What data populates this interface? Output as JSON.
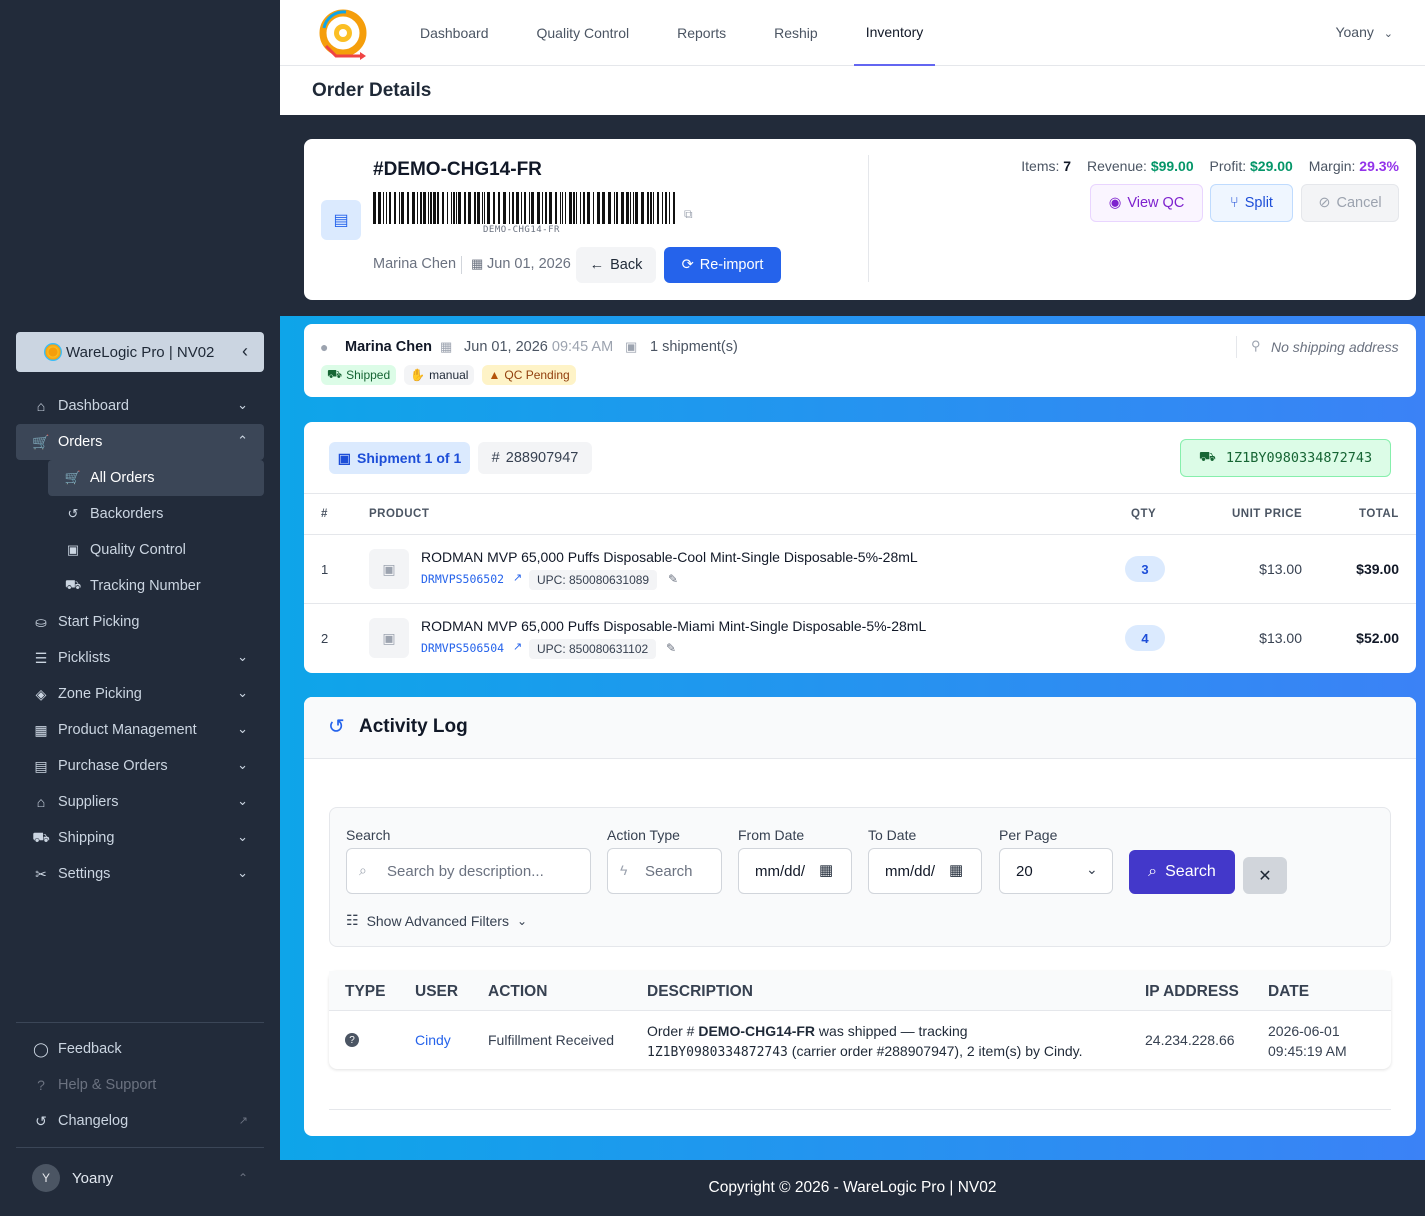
{
  "app": {
    "brand": "WareLogic Pro | NV02",
    "user": "Yoany",
    "user_initial": "Y"
  },
  "topnav": {
    "tabs": [
      "Dashboard",
      "Quality Control",
      "Reports",
      "Reship",
      "Inventory"
    ],
    "active": "Inventory"
  },
  "page": {
    "title": "Order Details"
  },
  "sidebar": {
    "items": [
      {
        "label": "Dashboard"
      },
      {
        "label": "Orders"
      },
      {
        "label": "All Orders"
      },
      {
        "label": "Backorders"
      },
      {
        "label": "Quality Control"
      },
      {
        "label": "Tracking Number"
      },
      {
        "label": "Start Picking"
      },
      {
        "label": "Picklists"
      },
      {
        "label": "Zone Picking"
      },
      {
        "label": "Product Management"
      },
      {
        "label": "Purchase Orders"
      },
      {
        "label": "Suppliers"
      },
      {
        "label": "Shipping"
      },
      {
        "label": "Settings"
      }
    ],
    "footer": [
      "Feedback",
      "Help & Support",
      "Changelog"
    ]
  },
  "order": {
    "number": "#DEMO-CHG14-FR",
    "barcode_text": "DEMO-CHG14-FR",
    "customer": "Marina Chen",
    "date": "Jun 01, 2026",
    "back_label": "Back",
    "reimport_label": "Re-import",
    "stats": {
      "items_label": "Items:",
      "items": "7",
      "revenue_label": "Revenue:",
      "revenue": "$99.00",
      "profit_label": "Profit:",
      "profit": "$29.00",
      "margin_label": "Margin:",
      "margin": "29.3%"
    },
    "actions": {
      "view_qc": "View QC",
      "split": "Split",
      "cancel": "Cancel"
    }
  },
  "summary": {
    "customer": "Marina Chen",
    "date": "Jun 01, 2026",
    "time": "09:45 AM",
    "shipments": "1 shipment(s)",
    "address": "No shipping address",
    "badges": [
      "Shipped",
      "manual",
      "QC Pending"
    ]
  },
  "shipment": {
    "label": "Shipment 1 of 1",
    "carrier_order": "288907947",
    "tracking": "1Z1BY0980334872743",
    "columns": [
      "#",
      "PRODUCT",
      "QTY",
      "UNIT PRICE",
      "TOTAL"
    ],
    "rows": [
      {
        "index": "1",
        "name": "RODMAN MVP 65,000 Puffs Disposable-Cool Mint-Single Disposable-5%-28mL",
        "sku": "DRMVPS506502",
        "upc": "UPC: 850080631089",
        "qty": "3",
        "unit": "$13.00",
        "total": "$39.00"
      },
      {
        "index": "2",
        "name": "RODMAN MVP 65,000 Puffs Disposable-Miami Mint-Single Disposable-5%-28mL",
        "sku": "DRMVPS506504",
        "upc": "UPC: 850080631102",
        "qty": "4",
        "unit": "$13.00",
        "total": "$52.00"
      }
    ]
  },
  "activity": {
    "title": "Activity Log",
    "filters": {
      "search_label": "Search",
      "search_placeholder": "Search by description...",
      "action_label": "Action Type",
      "action_placeholder": "Search",
      "from_label": "From Date",
      "from_value": "mm/dd/",
      "to_label": "To Date",
      "to_value": "mm/dd/",
      "per_page_label": "Per Page",
      "per_page": "20",
      "search_button": "Search",
      "advanced": "Show Advanced Filters"
    },
    "columns": [
      "TYPE",
      "USER",
      "ACTION",
      "DESCRIPTION",
      "IP ADDRESS",
      "DATE"
    ],
    "rows": [
      {
        "user": "Cindy",
        "action": "Fulfillment Received",
        "desc_pre": "Order # ",
        "desc_order": "DEMO-CHG14-FR",
        "desc_mid": " was shipped — tracking",
        "desc_tracking": "1Z1BY0980334872743",
        "desc_post": " (carrier order #288907947), 2 item(s) by Cindy.",
        "ip": "24.234.228.66",
        "date": "2026-06-01",
        "time": "09:45:19 AM"
      }
    ]
  },
  "footer": {
    "copyright": "Copyright © 2026 - WareLogic Pro | NV02"
  },
  "colors": {
    "accent": "#2563eb",
    "sidebar": "#222b3a",
    "revenue": "#059669",
    "margin": "#9333ea"
  }
}
